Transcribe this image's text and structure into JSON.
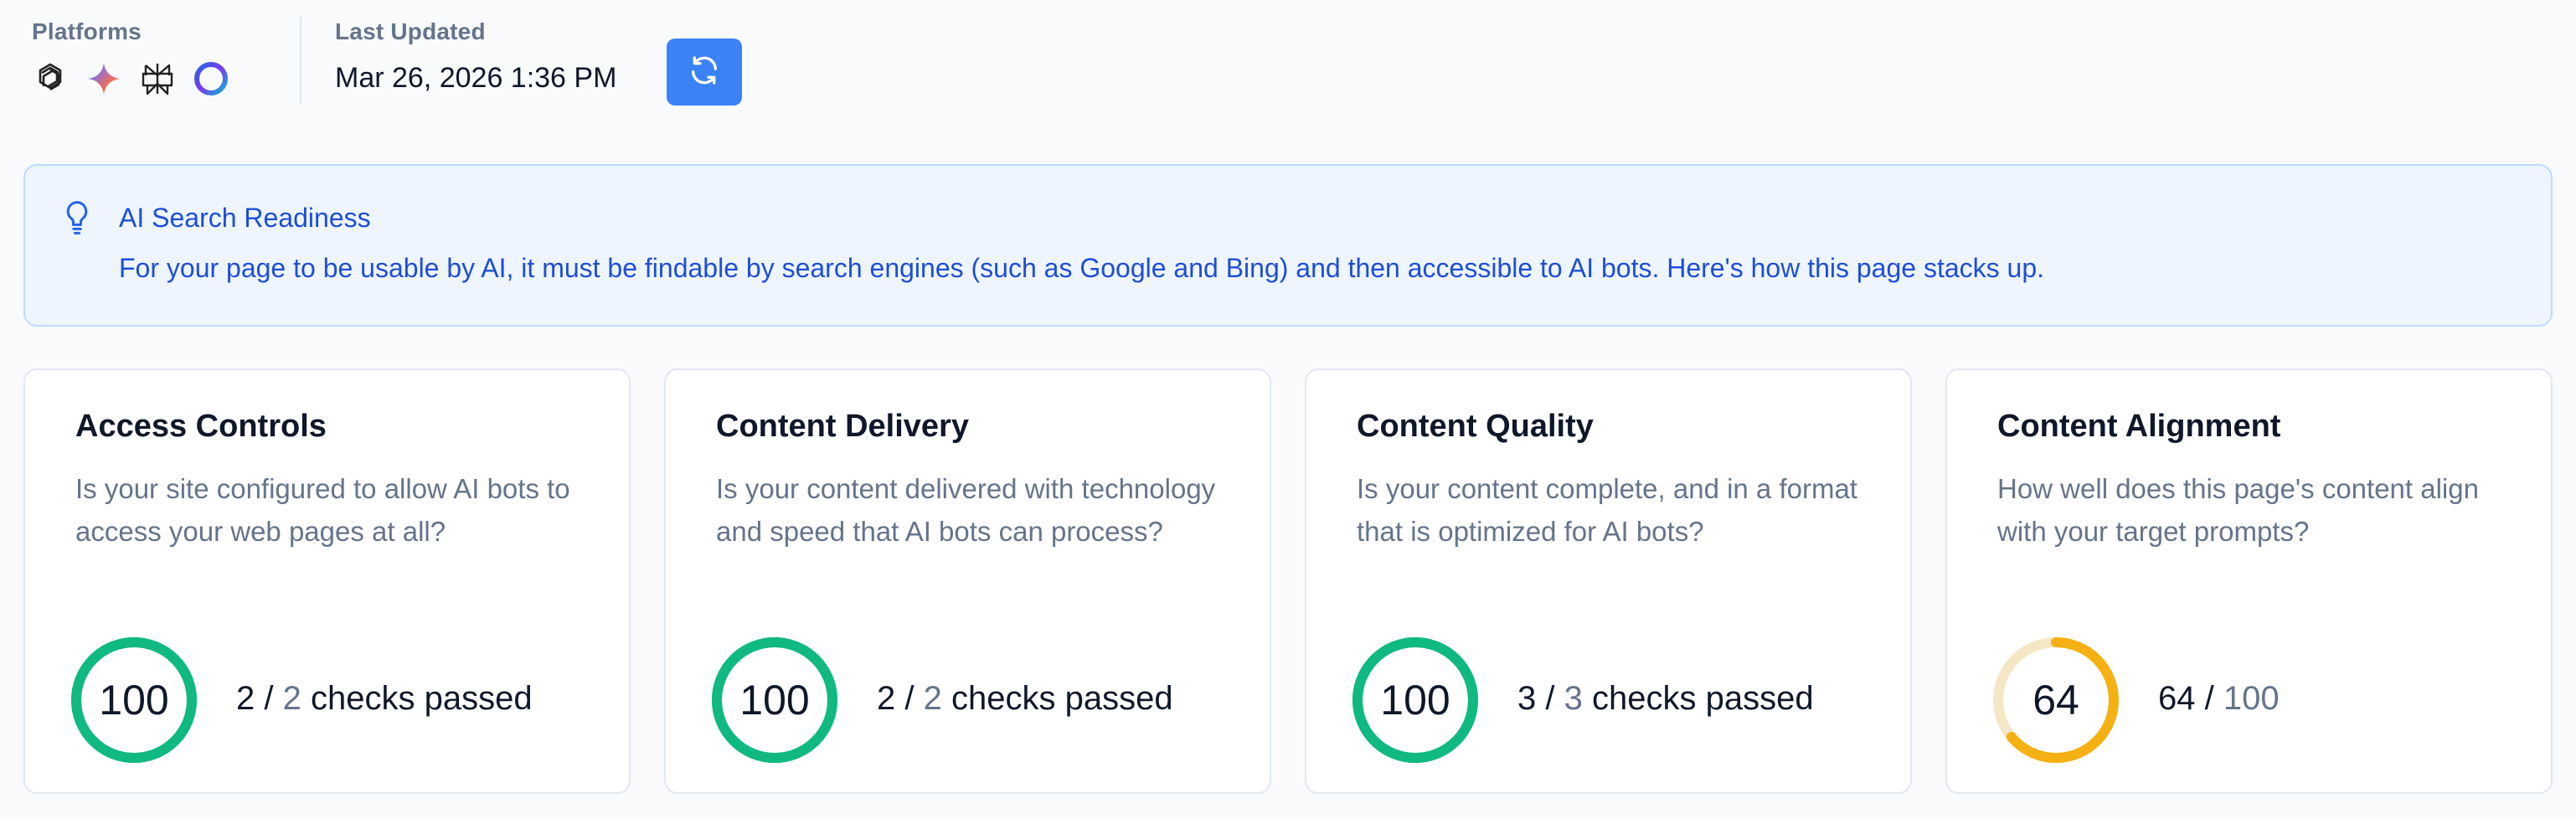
{
  "header": {
    "platforms_label": "Platforms",
    "platforms": [
      {
        "name": "ChatGPT",
        "icon": "openai-icon"
      },
      {
        "name": "Gemini",
        "icon": "gemini-icon"
      },
      {
        "name": "Perplexity",
        "icon": "perplexity-icon"
      },
      {
        "name": "Copilot",
        "icon": "copilot-icon"
      }
    ],
    "last_updated_label": "Last Updated",
    "last_updated_value": "Mar 26, 2026 1:36 PM",
    "refresh_icon": "refresh-icon"
  },
  "banner": {
    "icon": "lightbulb-icon",
    "title": "AI Search Readiness",
    "text": "For your page to be usable by AI, it must be findable by search engines (such as Google and Bing) and then accessible to AI bots. Here's how this page stacks up."
  },
  "cards": [
    {
      "title": "Access Controls",
      "description": "Is your site configured to allow AI bots to access your web pages at all?",
      "score": "100",
      "score_fraction": 1.0,
      "color": "#10b981",
      "passed": "2",
      "total": "2",
      "suffix": "checks passed"
    },
    {
      "title": "Content Delivery",
      "description": "Is your content delivered with technology and speed that AI bots can process?",
      "score": "100",
      "score_fraction": 1.0,
      "color": "#10b981",
      "passed": "2",
      "total": "2",
      "suffix": "checks passed"
    },
    {
      "title": "Content Quality",
      "description": "Is your content complete, and in a format that is optimized for AI bots?",
      "score": "100",
      "score_fraction": 1.0,
      "color": "#10b981",
      "passed": "3",
      "total": "3",
      "suffix": "checks passed"
    },
    {
      "title": "Content Alignment",
      "description": "How well does this page's content align with your target prompts?",
      "score": "64",
      "score_fraction": 0.64,
      "color": "#f5b014",
      "passed": "64",
      "total": "100",
      "suffix": ""
    }
  ],
  "colors": {
    "accent": "#3b82f6",
    "success": "#10b981",
    "warning": "#f5b014",
    "warning_track": "#f5e7c6",
    "banner_text": "#1d4ed8"
  }
}
